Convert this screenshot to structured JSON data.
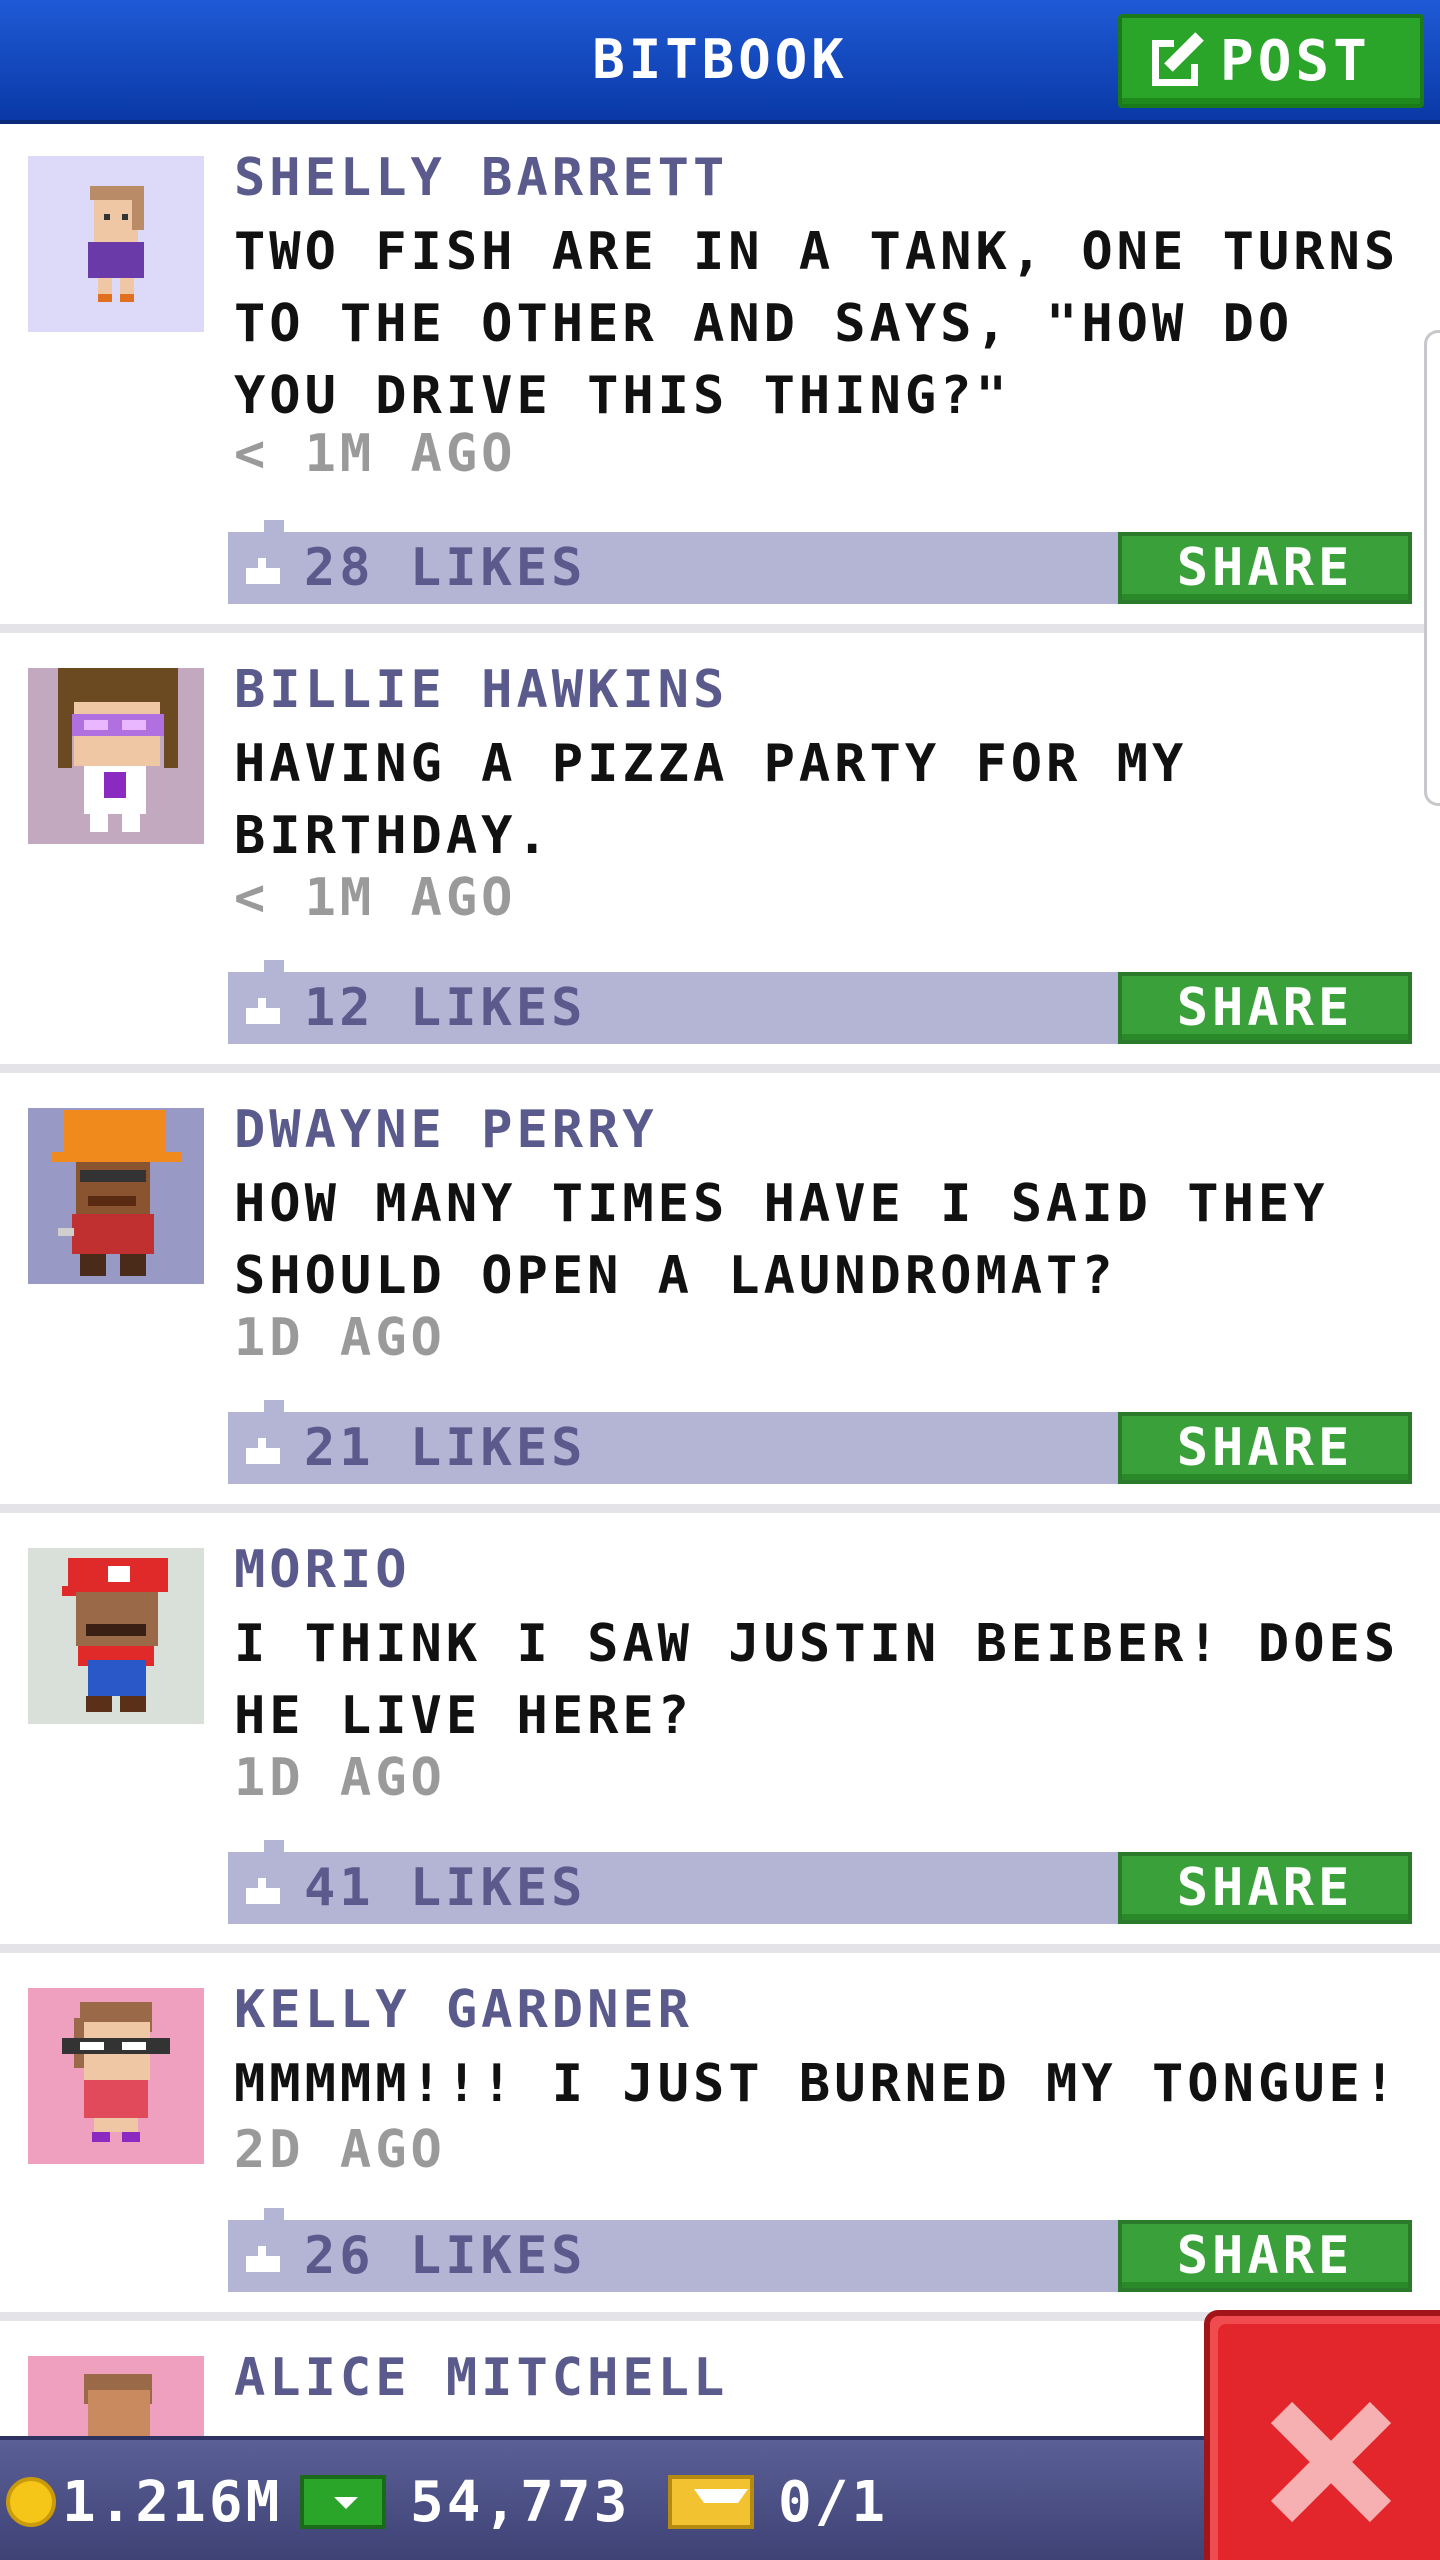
{
  "header": {
    "title": "BITBOOK",
    "post_label": "POST"
  },
  "posts": [
    {
      "author": "SHELLY BARRETT",
      "text": "TWO FISH ARE IN A TANK, ONE TURNS TO THE OTHER AND SAYS, \"HOW DO YOU DRIVE THIS THING?\"",
      "time": "< 1M AGO",
      "likes": "28 LIKES",
      "share": "SHARE",
      "avatar_bg": "#dcdaf8"
    },
    {
      "author": "BILLIE HAWKINS",
      "text": "HAVING A PIZZA PARTY FOR MY BIRTHDAY.",
      "time": "< 1M AGO",
      "likes": "12 LIKES",
      "share": "SHARE",
      "avatar_bg": "#c3a9c0"
    },
    {
      "author": "DWAYNE PERRY",
      "text": "HOW MANY TIMES HAVE I SAID THEY SHOULD OPEN A LAUNDROMAT?",
      "time": "1D AGO",
      "likes": "21 LIKES",
      "share": "SHARE",
      "avatar_bg": "#9999c5"
    },
    {
      "author": "MORIO",
      "text": "I THINK I SAW JUSTIN BEIBER! DOES HE LIVE HERE?",
      "time": "1D AGO",
      "likes": "41 LIKES",
      "share": "SHARE",
      "avatar_bg": "#d9e0da"
    },
    {
      "author": "KELLY GARDNER",
      "text": "MMMMM!!! I JUST BURNED MY TONGUE!",
      "time": "2D AGO",
      "likes": "26 LIKES",
      "share": "SHARE",
      "avatar_bg": "#f0a0bf"
    },
    {
      "author": "ALICE MITCHELL",
      "avatar_bg": "#f0a0bf"
    }
  ],
  "status": {
    "coins": "1.216M",
    "bux": "54,773",
    "tickets": "0/1"
  },
  "colors": {
    "header": "#1a4fc8",
    "accent_green": "#3aa03a",
    "like_bar": "#b4b5d5",
    "name": "#5a5a8c",
    "close": "#e3262b"
  }
}
